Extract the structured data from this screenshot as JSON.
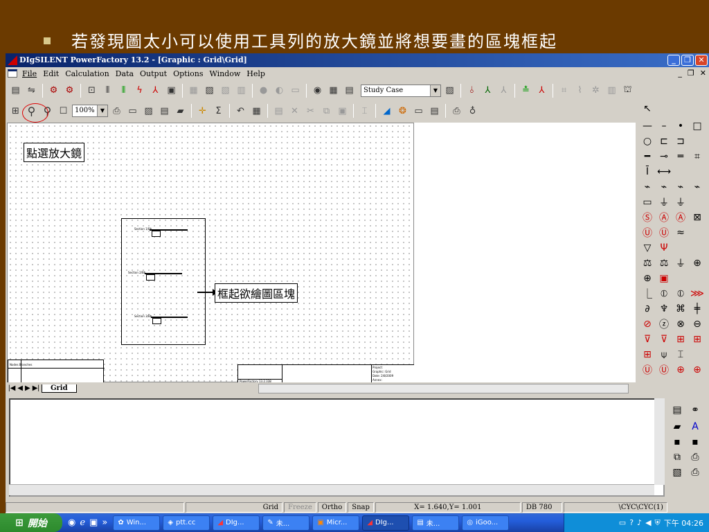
{
  "slide": {
    "instruction": "若發現圖太小可以使用工具列的放大鏡並將想要畫的區塊框起"
  },
  "window": {
    "title": "DIgSILENT PowerFactory 13.2 - [Graphic : Grid\\Grid]",
    "minimize": "_",
    "restore": "❐",
    "close": "✕"
  },
  "menu": {
    "items": [
      "File",
      "Edit",
      "Calculation",
      "Data",
      "Output",
      "Options",
      "Window",
      "Help"
    ],
    "mdi_controls": [
      "_",
      "❐",
      "✕"
    ]
  },
  "toolbar1": {
    "study_case_value": "Study Case"
  },
  "toolbar2": {
    "zoom_value": "100%"
  },
  "canvas": {
    "callout_zoom": "點選放大鏡",
    "callout_area": "框起欲繪圖區塊",
    "bus_labels": [
      "Section 1/Bb",
      "Section 2/Bb",
      "Section 3/Bb"
    ],
    "titleblock_left": "Nodes  Branches",
    "titleblock_mid": "PowerFactory 13.2.338",
    "titleblock_right": [
      "Project:",
      "Graphic: Grid",
      "Date:   2/8/2009",
      "Annex:"
    ]
  },
  "tabs": {
    "active": "Grid"
  },
  "statusbar": {
    "grid": "Grid",
    "freeze": "Freeze",
    "ortho": "Ortho",
    "snap": "Snap",
    "coords": "X=    1.640,Y=    1.001",
    "db": "DB 780",
    "path": "\\CYC\\CYC(1)"
  },
  "taskbar": {
    "start": "開始",
    "buttons": [
      "Win...",
      "ptt.cc",
      "DIg...",
      "未...",
      "Micr...",
      "DIg...",
      "未...",
      "iGoo..."
    ],
    "clock": "下午 04:26"
  },
  "colors": {
    "slide_bg": "#6b3a00",
    "title_bar": "#0a246a",
    "highlight_ring": "#d00000"
  }
}
